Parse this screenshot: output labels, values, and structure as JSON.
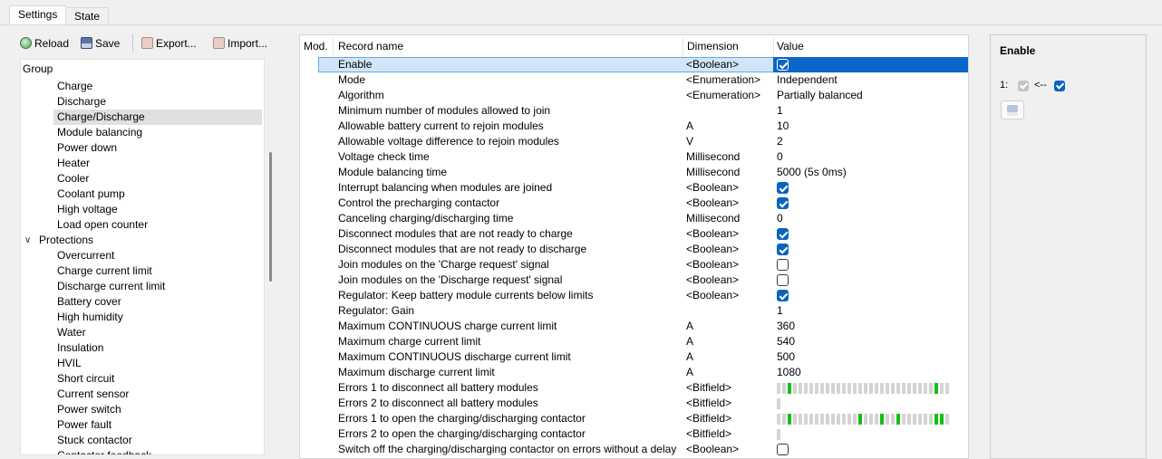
{
  "tabs": [
    {
      "label": "Settings"
    },
    {
      "label": "State"
    }
  ],
  "toolbar": {
    "reload": "Reload",
    "save": "Save",
    "export": "Export...",
    "import": "Import..."
  },
  "tree": {
    "root": "Group",
    "items": [
      {
        "label": "Charge",
        "level": 2,
        "selected": false
      },
      {
        "label": "Discharge",
        "level": 2,
        "selected": false
      },
      {
        "label": "Charge/Discharge",
        "level": 2,
        "selected": true
      },
      {
        "label": "Module balancing",
        "level": 2,
        "selected": false
      },
      {
        "label": "Power down",
        "level": 2,
        "selected": false
      },
      {
        "label": "Heater",
        "level": 2,
        "selected": false
      },
      {
        "label": "Cooler",
        "level": 2,
        "selected": false
      },
      {
        "label": "Coolant pump",
        "level": 2,
        "selected": false
      },
      {
        "label": "High voltage",
        "level": 2,
        "selected": false
      },
      {
        "label": "Load open counter",
        "level": 2,
        "selected": false
      },
      {
        "label": "Protections",
        "level": 1,
        "expanded": true,
        "selected": false
      },
      {
        "label": "Overcurrent",
        "level": 2,
        "selected": false
      },
      {
        "label": "Charge current limit",
        "level": 2,
        "selected": false
      },
      {
        "label": "Discharge current limit",
        "level": 2,
        "selected": false
      },
      {
        "label": "Battery cover",
        "level": 2,
        "selected": false
      },
      {
        "label": "High humidity",
        "level": 2,
        "selected": false
      },
      {
        "label": "Water",
        "level": 2,
        "selected": false
      },
      {
        "label": "Insulation",
        "level": 2,
        "selected": false
      },
      {
        "label": "HVIL",
        "level": 2,
        "selected": false
      },
      {
        "label": "Short circuit",
        "level": 2,
        "selected": false
      },
      {
        "label": "Current sensor",
        "level": 2,
        "selected": false
      },
      {
        "label": "Power switch",
        "level": 2,
        "selected": false
      },
      {
        "label": "Power fault",
        "level": 2,
        "selected": false
      },
      {
        "label": "Stuck contactor",
        "level": 2,
        "selected": false
      },
      {
        "label": "Contactor feedback",
        "level": 2,
        "selected": false
      }
    ]
  },
  "grid": {
    "headers": {
      "mod": "Mod.",
      "name": "Record name",
      "dim": "Dimension",
      "val": "Value"
    },
    "rows": [
      {
        "name": "Enable",
        "dim": "<Boolean>",
        "type": "bool",
        "checked": true,
        "selected": true
      },
      {
        "name": "Mode",
        "dim": "<Enumeration>",
        "type": "text",
        "value": "Independent"
      },
      {
        "name": "Algorithm",
        "dim": "<Enumeration>",
        "type": "text",
        "value": "Partially balanced"
      },
      {
        "name": "Minimum number of modules allowed to join",
        "dim": "",
        "type": "text",
        "value": "1"
      },
      {
        "name": "Allowable battery current to rejoin modules",
        "dim": "A",
        "type": "text",
        "value": "10"
      },
      {
        "name": "Allowable voltage difference to rejoin modules",
        "dim": "V",
        "type": "text",
        "value": "2"
      },
      {
        "name": "Voltage check time",
        "dim": "Millisecond",
        "type": "text",
        "value": "0"
      },
      {
        "name": "Module balancing time",
        "dim": "Millisecond",
        "type": "text",
        "value": "5000 (5s 0ms)"
      },
      {
        "name": "Interrupt balancing when modules are joined",
        "dim": "<Boolean>",
        "type": "bool",
        "checked": true
      },
      {
        "name": "Control the precharging contactor",
        "dim": "<Boolean>",
        "type": "bool",
        "checked": true
      },
      {
        "name": "Canceling charging/discharging time",
        "dim": "Millisecond",
        "type": "text",
        "value": "0"
      },
      {
        "name": "Disconnect modules that are not ready to charge",
        "dim": "<Boolean>",
        "type": "bool",
        "checked": true
      },
      {
        "name": "Disconnect modules that are not ready to discharge",
        "dim": "<Boolean>",
        "type": "bool",
        "checked": true
      },
      {
        "name": "Join modules on the 'Charge request' signal",
        "dim": "<Boolean>",
        "type": "bool",
        "checked": false
      },
      {
        "name": "Join modules on the 'Discharge request' signal",
        "dim": "<Boolean>",
        "type": "bool",
        "checked": false
      },
      {
        "name": "Regulator: Keep battery module currents below limits",
        "dim": "<Boolean>",
        "type": "bool",
        "checked": true
      },
      {
        "name": "Regulator: Gain",
        "dim": "",
        "type": "text",
        "value": "1"
      },
      {
        "name": "Maximum CONTINUOUS charge current limit",
        "dim": "A",
        "type": "text",
        "value": "360"
      },
      {
        "name": "Maximum charge current limit",
        "dim": "A",
        "type": "text",
        "value": "540"
      },
      {
        "name": "Maximum CONTINUOUS discharge current limit",
        "dim": "A",
        "type": "text",
        "value": "500"
      },
      {
        "name": "Maximum discharge current limit",
        "dim": "A",
        "type": "text",
        "value": "1080"
      },
      {
        "name": "Errors 1 to disconnect all battery modules",
        "dim": "<Bitfield>",
        "type": "bits",
        "count": 32,
        "set": [
          2,
          29
        ]
      },
      {
        "name": "Errors 2 to disconnect all battery modules",
        "dim": "<Bitfield>",
        "type": "bits",
        "count": 1,
        "set": []
      },
      {
        "name": "Errors 1 to open the charging/discharging contactor",
        "dim": "<Bitfield>",
        "type": "bits",
        "count": 32,
        "set": [
          2,
          15,
          19,
          22,
          29,
          30
        ]
      },
      {
        "name": "Errors 2 to open the charging/discharging contactor",
        "dim": "<Bitfield>",
        "type": "bits",
        "count": 1,
        "set": []
      },
      {
        "name": "Switch off the charging/discharging contactor on errors without a delay",
        "dim": "<Boolean>",
        "type": "bool",
        "checked": false
      }
    ]
  },
  "panel": {
    "title": "Enable",
    "index": "1:",
    "arrow": "<--",
    "default_checked": true,
    "value_checked": true
  },
  "colors": {
    "selection": "#0a66c8",
    "row_highlight": "#d0e6f8",
    "bit_on": "#13c013",
    "bit_off": "#d4d4d4"
  }
}
